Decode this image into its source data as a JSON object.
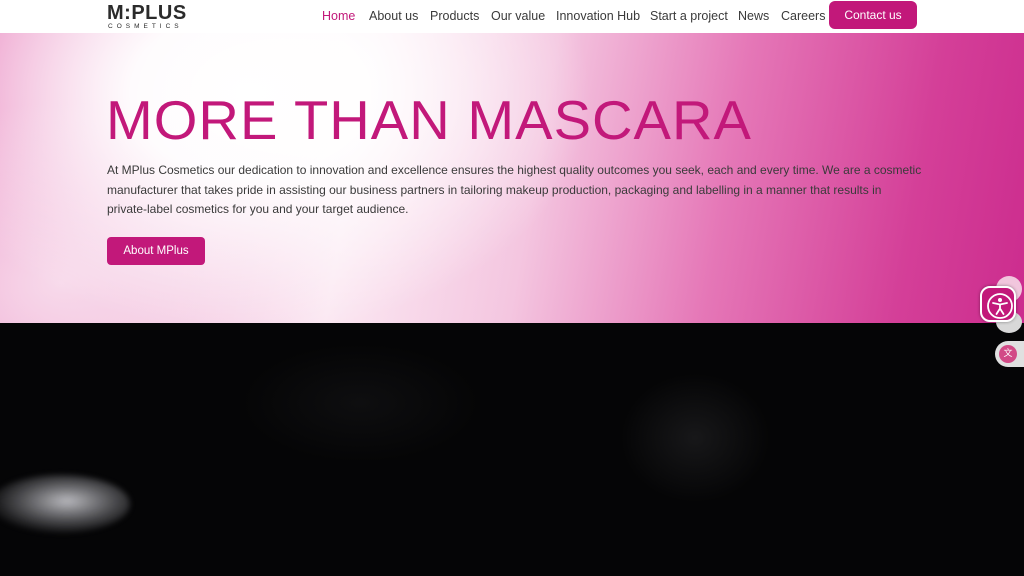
{
  "brand": {
    "logo_main": "M:PLUS",
    "logo_sub": "COSMETICS"
  },
  "nav": {
    "items": [
      {
        "label": "Home",
        "active": true
      },
      {
        "label": "About us",
        "active": false
      },
      {
        "label": "Products",
        "active": false
      },
      {
        "label": "Our value",
        "active": false
      },
      {
        "label": "Innovation Hub",
        "active": false
      },
      {
        "label": "Start a project",
        "active": false
      },
      {
        "label": "News",
        "active": false
      },
      {
        "label": "Careers",
        "active": false
      }
    ],
    "contact_label": "Contact us"
  },
  "hero": {
    "title": "MORE THAN MASCARA",
    "text": "At MPlus Cosmetics our dedication to innovation and excellence ensures the highest quality outcomes you seek, each and every time. We are a cosmetic manufacturer that takes pride in assisting our business partners in tailoring makeup production, packaging and labelling in a manner that results in private-label cosmetics for you and your target audience.",
    "button_label": "About MPlus"
  },
  "widgets": {
    "accessibility_icon": "accessibility-icon",
    "translate_icon": "translate-icon"
  },
  "colors": {
    "accent": "#c2187a",
    "text": "#3a3a3a"
  }
}
